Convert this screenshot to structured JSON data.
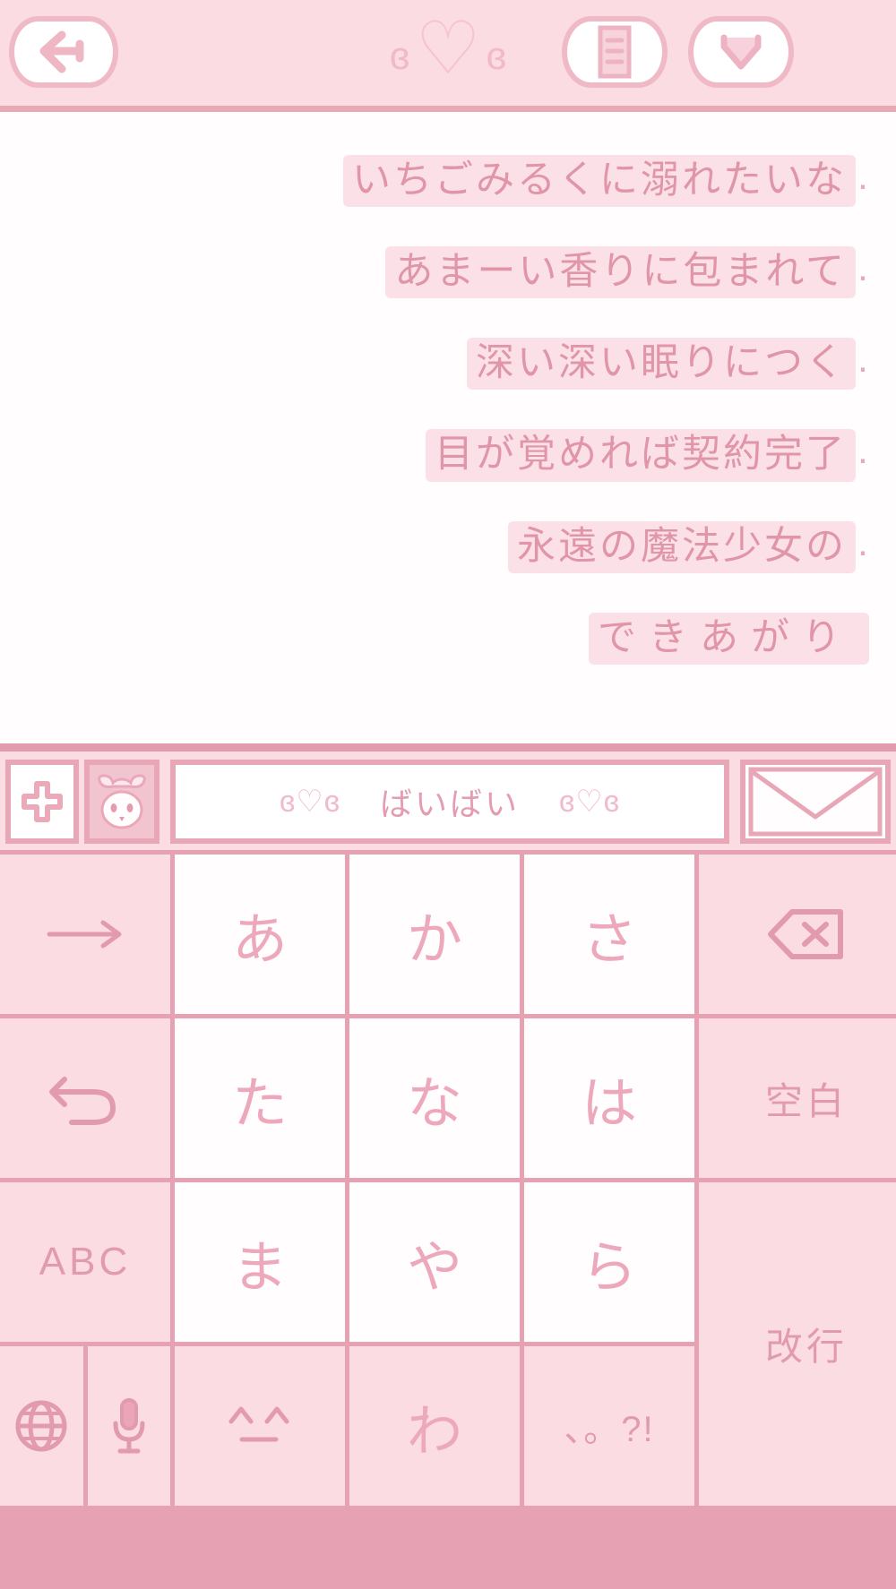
{
  "theme": {
    "bg_pink": "#fbdce2",
    "line_pink": "#e6a2b3",
    "text_pink": "#e29bae",
    "highlight_pink": "#fbe0e7",
    "white": "#fffdfe"
  },
  "navbar": {
    "back_icon": "back-arrow-icon",
    "title_left_wing": "ɞ",
    "title_heart": "♡",
    "title_right_wing": "ɞ",
    "list_icon": "list-icon",
    "heart_icon": "heart-chevron-icon"
  },
  "note": {
    "lines": [
      {
        "text": "いちごみるくに溺れたいな",
        "punct": "."
      },
      {
        "text": "あまーい香りに包まれて",
        "punct": "."
      },
      {
        "text": "深い深い眠りにつく",
        "punct": "."
      },
      {
        "text": "目が覚めれば契約完了",
        "punct": "."
      },
      {
        "text": "永遠の魔法少女の",
        "punct": "."
      },
      {
        "text": "できあがり",
        "punct": "",
        "spaced": true
      }
    ]
  },
  "keyboard": {
    "toolbar": {
      "add_label": "＋",
      "character_icon": "mascot-face-icon",
      "suggestion_left_kaomoji": "ɞ♡ɞ",
      "suggestion_word": "ばいばい",
      "suggestion_right_kaomoji": "ɞ♡ɞ",
      "mail_icon": "envelope-icon"
    },
    "rows": [
      [
        {
          "name": "cursor-right-key",
          "label": "→",
          "style": "icon"
        },
        {
          "name": "key-a",
          "label": "あ",
          "style": "kana"
        },
        {
          "name": "key-ka",
          "label": "か",
          "style": "kana"
        },
        {
          "name": "key-sa",
          "label": "さ",
          "style": "kana"
        },
        {
          "name": "backspace-key",
          "label": "⌫",
          "style": "icon"
        }
      ],
      [
        {
          "name": "undo-key",
          "label": "↰",
          "style": "icon"
        },
        {
          "name": "key-ta",
          "label": "た",
          "style": "kana"
        },
        {
          "name": "key-na",
          "label": "な",
          "style": "kana"
        },
        {
          "name": "key-ha",
          "label": "は",
          "style": "kana"
        },
        {
          "name": "space-key",
          "label": "空白",
          "style": "label-sm"
        }
      ],
      [
        {
          "name": "abc-key",
          "label": "ABC",
          "style": "abc"
        },
        {
          "name": "key-ma",
          "label": "ま",
          "style": "kana"
        },
        {
          "name": "key-ya",
          "label": "や",
          "style": "kana"
        },
        {
          "name": "key-ra",
          "label": "ら",
          "style": "kana"
        },
        {
          "name": "enter-key",
          "label": "改行",
          "style": "label-sm"
        }
      ],
      [
        {
          "name": "globe-key",
          "label": "🌐",
          "style": "icon"
        },
        {
          "name": "mic-key",
          "label": "🎤",
          "style": "icon"
        },
        {
          "name": "emoticon-key",
          "label": "^_^",
          "style": "punc"
        },
        {
          "name": "key-wa",
          "label": "わ",
          "style": "kana"
        },
        {
          "name": "punctuation-key",
          "label": "、。?!",
          "style": "punc"
        }
      ]
    ]
  }
}
